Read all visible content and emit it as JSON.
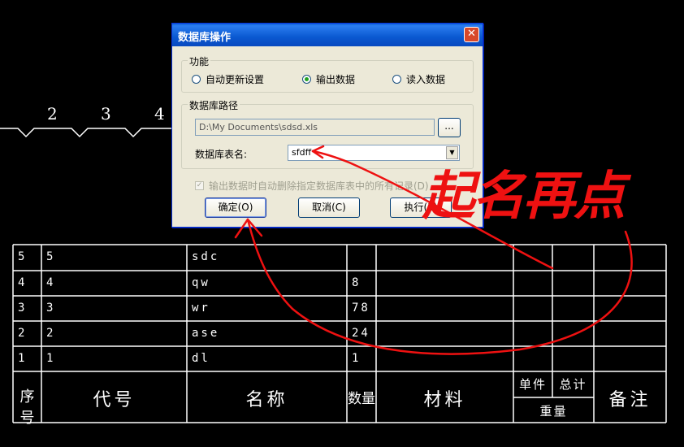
{
  "dialog": {
    "title": "数据库操作",
    "close": "✕",
    "function_group": {
      "label": "功能",
      "options": [
        "自动更新设置",
        "输出数据",
        "读入数据"
      ],
      "selected": "输出数据"
    },
    "path_group": {
      "label": "数据库路径",
      "path_value": "D:\\My Documents\\sdsd.xls",
      "browse_label": "...",
      "table_name_label": "数据库表名:",
      "table_name_value": "sfdff"
    },
    "checkbox_label": "输出数据时自动删除指定数据库表中的所有记录(D)",
    "buttons": {
      "ok": "确定(O)",
      "cancel": "取消(C)",
      "execute": "执行(E)"
    }
  },
  "annotation": {
    "handwritten": "起名再点",
    "color": "#ee1111"
  },
  "balloons": [
    "2",
    "3",
    "4"
  ],
  "bom": {
    "rows": [
      {
        "seq": "5",
        "code": "5",
        "name": "sdc",
        "qty": ""
      },
      {
        "seq": "4",
        "code": "4",
        "name": "qw",
        "qty": "8"
      },
      {
        "seq": "3",
        "code": "3",
        "name": "wr",
        "qty": "78"
      },
      {
        "seq": "2",
        "code": "2",
        "name": "ase",
        "qty": "24"
      },
      {
        "seq": "1",
        "code": "1",
        "name": "dl",
        "qty": "1"
      }
    ],
    "headers": {
      "seq": "序号",
      "code": "代号",
      "name": "名称",
      "qty": "数量",
      "material": "材料",
      "unit": "单件",
      "total": "总计",
      "weight": "重量",
      "note": "备注"
    }
  }
}
